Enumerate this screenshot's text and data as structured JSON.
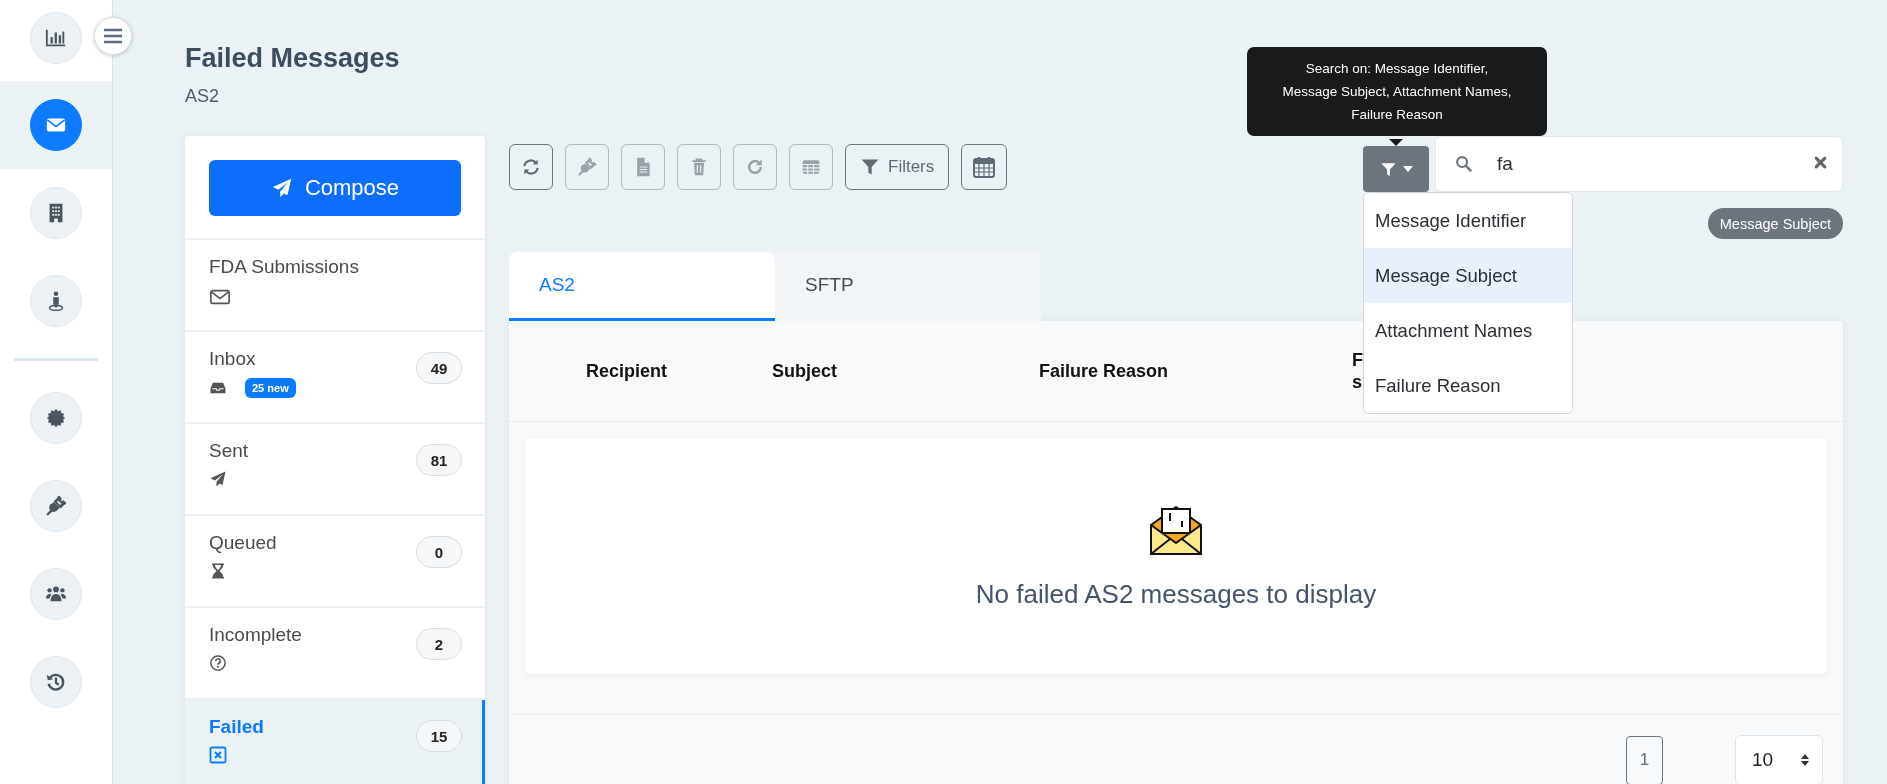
{
  "nav": {
    "top": [
      {
        "kind": "chart",
        "selected": false
      },
      {
        "kind": "mail",
        "selected": true
      },
      {
        "kind": "building",
        "selected": false
      },
      {
        "kind": "person",
        "selected": false
      }
    ],
    "bottom": [
      {
        "kind": "badge",
        "selected": false
      },
      {
        "kind": "plug",
        "selected": false
      },
      {
        "kind": "users",
        "selected": false
      },
      {
        "kind": "history",
        "selected": false
      }
    ]
  },
  "page": {
    "title": "Failed Messages",
    "subtitle": "AS2"
  },
  "mailboxes": {
    "compose": "Compose",
    "items": [
      {
        "label": "FDA Submissions",
        "kind": "envelope",
        "selected": false
      },
      {
        "label": "Inbox",
        "count": "49",
        "new_badge": "25 new",
        "kind": "inbox",
        "selected": false
      },
      {
        "label": "Sent",
        "count": "81",
        "kind": "sent",
        "selected": false
      },
      {
        "label": "Queued",
        "count": "0",
        "kind": "hourglass",
        "selected": false
      },
      {
        "label": "Incomplete",
        "count": "2",
        "kind": "question",
        "selected": false
      },
      {
        "label": "Failed",
        "count": "15",
        "kind": "failed",
        "selected": true
      }
    ]
  },
  "toolbar": {
    "buttons": [
      {
        "kind": "refresh",
        "disabled": false
      },
      {
        "kind": "plug",
        "disabled": true
      },
      {
        "kind": "file",
        "disabled": true
      },
      {
        "kind": "trash",
        "disabled": true
      },
      {
        "kind": "redo",
        "disabled": true
      },
      {
        "kind": "table",
        "disabled": true
      },
      {
        "kind": "filters",
        "label": "Filters",
        "disabled": false
      },
      {
        "kind": "calendar",
        "disabled": false
      }
    ]
  },
  "search": {
    "tooltip": "Search on: Message Identifier, Message Subject, Attachment Names, Failure Reason",
    "value": "fa",
    "active_field": "Message Subject",
    "field_options": [
      {
        "label": "Message Identifier",
        "selected": false
      },
      {
        "label": "Message Subject",
        "selected": true
      },
      {
        "label": "Attachment Names",
        "selected": false
      },
      {
        "label": "Failure Reason",
        "selected": false
      }
    ]
  },
  "tabs": [
    {
      "label": "AS2",
      "selected": true
    },
    {
      "label": "SFTP",
      "selected": false
    }
  ],
  "table": {
    "columns": [
      "Recipient",
      "Subject",
      "Failure Reason"
    ],
    "column_4": [
      "F",
      "s"
    ],
    "empty_message": "No failed AS2 messages to display"
  },
  "pagination": {
    "pages": [
      "1"
    ],
    "page_size": "10"
  }
}
